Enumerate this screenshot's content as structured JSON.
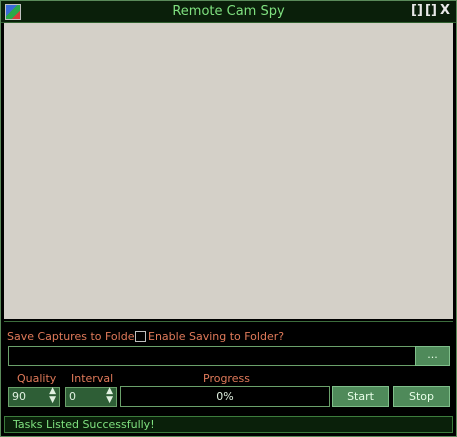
{
  "window": {
    "title": "Remote Cam Spy",
    "icon": "app-icon",
    "controls": [
      "[]",
      "[]",
      "X"
    ]
  },
  "capture": {
    "save_label": "Save Captures to Folder:",
    "enable_saving_label": "Enable Saving to Folder?",
    "enable_saving_checked": false,
    "folder_path": "",
    "browse_label": "..."
  },
  "settings": {
    "quality_label": "Quality",
    "quality_value": "90",
    "interval_label": "Interval",
    "interval_value": "0",
    "progress_label": "Progress",
    "progress_value": "0%",
    "start_label": "Start",
    "stop_label": "Stop"
  },
  "status": {
    "text": "Tasks Listed Successfully!"
  },
  "colors": {
    "accent_green": "#7fe07f",
    "label_orange": "#e07a5a",
    "button_green": "#4f8a5a",
    "canvas_gray": "#d4d0c8"
  }
}
